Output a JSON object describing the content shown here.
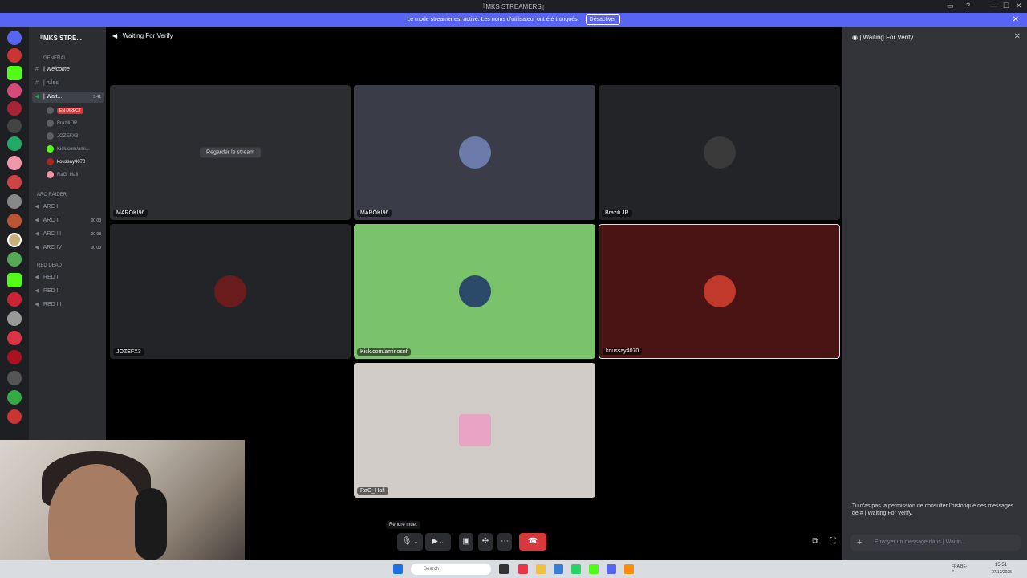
{
  "titlebar": {
    "title": "『MKS STREAMERS』"
  },
  "banner": {
    "text": "Le mode streamer est activé. Les noms d'utilisateur ont été tronqués.",
    "button": "Désactiver"
  },
  "server": {
    "name": "『MKS STRE..."
  },
  "channels": {
    "cat_general": "GENERAL",
    "welcome": "| Welcome",
    "rules": "| rules",
    "waiting": "| Wait...",
    "waiting_time": "3:41",
    "users": [
      {
        "name": "",
        "badge": "EN DIRECT"
      },
      {
        "name": "Brazili JR"
      },
      {
        "name": "JOZEFX3"
      },
      {
        "name": "Kick.com/ami..."
      },
      {
        "name": "koussay4070"
      },
      {
        "name": "RaG_Hafi"
      }
    ],
    "cat_arc": "ARC RAIDER",
    "arc": [
      {
        "name": "ARC I",
        "count": ""
      },
      {
        "name": "ARC II",
        "count": "00 03"
      },
      {
        "name": "ARC III",
        "count": "00 03"
      },
      {
        "name": "ARC IV",
        "count": "00 03"
      }
    ],
    "cat_red": "RED DEAD",
    "red": [
      {
        "name": "RED I"
      },
      {
        "name": "RED II"
      },
      {
        "name": "RED III"
      }
    ]
  },
  "stage": {
    "title": "| Waiting For Verify"
  },
  "tiles": [
    {
      "name": "MAROKI96",
      "watch": "Regarder le stream",
      "bg": "#2b2d31"
    },
    {
      "name": "MAROKI96",
      "bg": "#3a3c48"
    },
    {
      "name": "Brazili JR",
      "bg": "#232428"
    },
    {
      "name": "JOZEFX3",
      "bg": "#232428"
    },
    {
      "name": "Kick.com/aminosnf",
      "bg": "#7ac36a"
    },
    {
      "name": "koussay4070",
      "bg": "#4a1414"
    },
    {
      "name": "RaG_Hafi",
      "bg": "#d2ccc8"
    }
  ],
  "controls": {
    "tooltip": "Rendre muet"
  },
  "rightpanel": {
    "title": "| Waiting For Verify",
    "permission": "Tu n'as pas la permission de consulter l'historique des messages de # | Waiting For Verify.",
    "input_placeholder": "Envoyer un message dans | Waitin..."
  },
  "taskbar": {
    "search": "Search",
    "lang": "FRA BE-fr",
    "time": "15:51",
    "date": "07/12/2025"
  }
}
